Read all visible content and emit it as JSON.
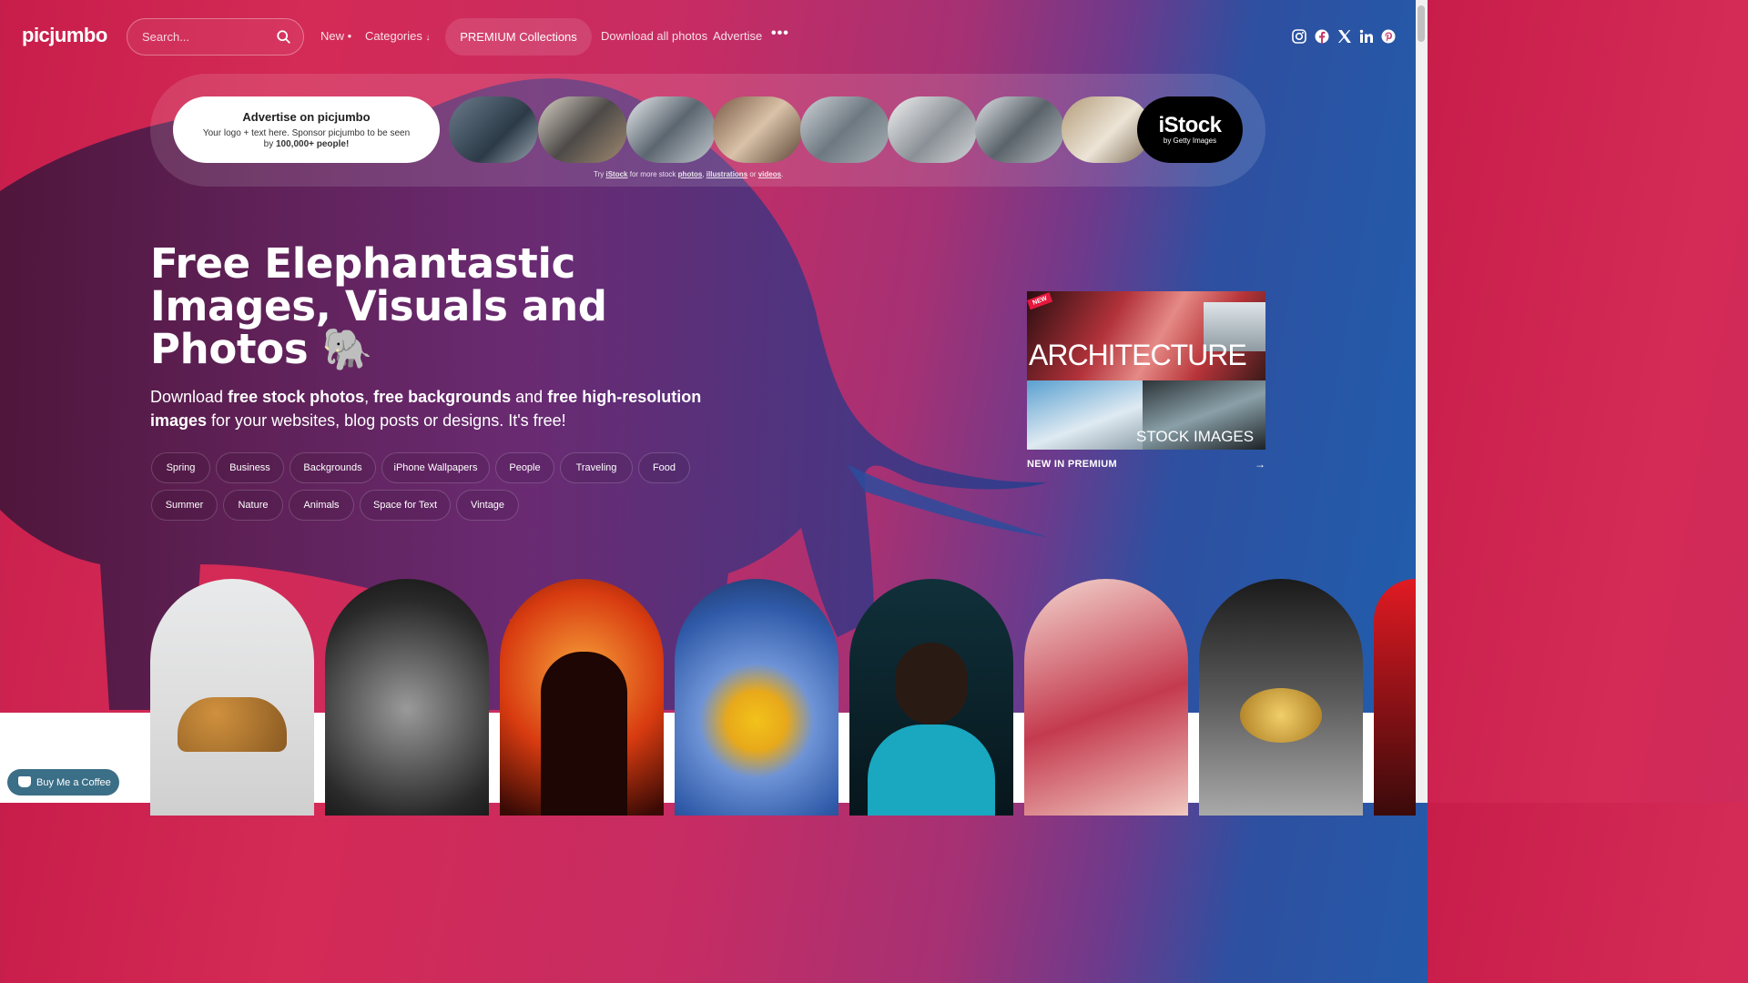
{
  "header": {
    "logo": "picjumbo",
    "search_placeholder": "Search...",
    "nav_new": "New",
    "nav_categories": "Categories",
    "premium_button": "PREMIUM Collections",
    "download_all": "Download all photos",
    "advertise": "Advertise",
    "more_icon": "•••",
    "social": [
      "instagram-icon",
      "facebook-icon",
      "x-icon",
      "linkedin-icon",
      "pinterest-icon"
    ]
  },
  "ad_banner": {
    "title": "Advertise on picjumbo",
    "text_part1": "Your logo + text here. Sponsor picjumbo to be seen by ",
    "text_bold": "100,000+ people!",
    "istock_logo": "iStock",
    "istock_sub": "by Getty Images",
    "try_text": "Try",
    "try_link": "iStock",
    "try_mid": "for more stock",
    "link_photos": "photos",
    "link_illustrations": "illustrations",
    "link_or": "or",
    "link_videos": "videos"
  },
  "hero": {
    "title_line1": "Free Elephantastic",
    "title_line2": "Images, Visuals and",
    "title_line3": "Photos 🐘",
    "sub_1": "Download ",
    "sub_b1": "free stock photos",
    "sub_2": ", ",
    "sub_b2": "free backgrounds",
    "sub_3": " and ",
    "sub_b3": "free high-resolution images",
    "sub_4": " for your websites, blog posts or designs. It's free!"
  },
  "tags": [
    "Spring",
    "Business",
    "Backgrounds",
    "iPhone Wallpapers",
    "People",
    "Traveling",
    "Food",
    "Summer",
    "Nature",
    "Animals",
    "Space for Text",
    "Vintage"
  ],
  "premium_card": {
    "badge": "NEW",
    "heading": "ARCHITECTURE",
    "stock": "STOCK IMAGES",
    "label": "NEW IN PREMIUM",
    "arrow": "→"
  },
  "coffee": "Buy Me a Coffee",
  "colors": {
    "accent": "#d42a56",
    "blue": "#1f5fae",
    "coffee": "#3b6e87"
  }
}
